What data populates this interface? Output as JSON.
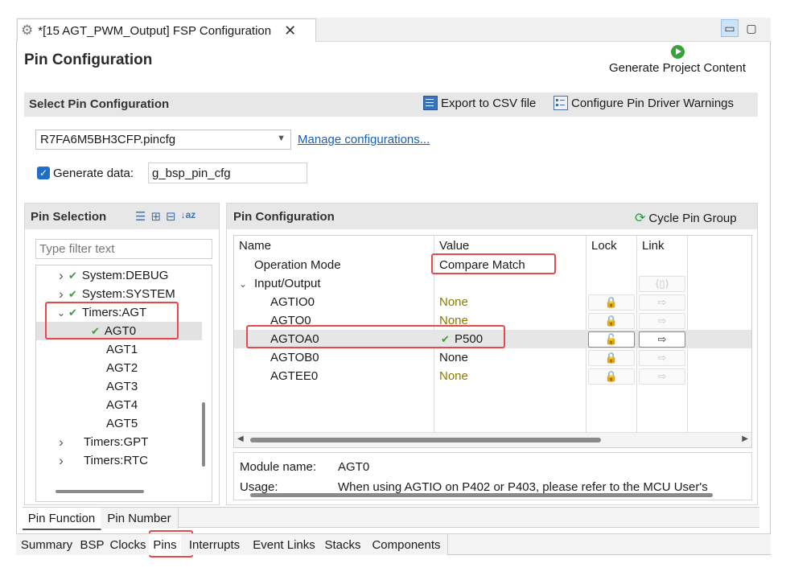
{
  "window": {
    "tab_title": "*[15 AGT_PWM_Output] FSP Configuration",
    "minimize_icon": "minimize-icon",
    "maximize_icon": "maximize-icon"
  },
  "header": {
    "title": "Pin Configuration",
    "generate_label": "Generate Project Content"
  },
  "select_config": {
    "title": "Select Pin Configuration",
    "export_label": "Export to CSV file",
    "warnings_label": "Configure Pin Driver Warnings",
    "config_value": "R7FA6M5BH3CFP.pincfg",
    "manage_link": "Manage configurations...",
    "generate_data_label": "Generate data:",
    "generate_data_checked": true,
    "generate_data_value": "g_bsp_pin_cfg"
  },
  "pin_selection": {
    "title": "Pin Selection",
    "filter_placeholder": "Type filter text",
    "tree": [
      {
        "label": "System:DEBUG",
        "indent": 1,
        "expander": "collapsed",
        "checked": true
      },
      {
        "label": "System:SYSTEM",
        "indent": 1,
        "expander": "collapsed",
        "checked": true
      },
      {
        "label": "Timers:AGT",
        "indent": 1,
        "expander": "expanded",
        "checked": true
      },
      {
        "label": "AGT0",
        "indent": 2,
        "expander": "none",
        "checked": true,
        "selected": true
      },
      {
        "label": "AGT1",
        "indent": 2,
        "expander": "none",
        "checked": false
      },
      {
        "label": "AGT2",
        "indent": 2,
        "expander": "none",
        "checked": false
      },
      {
        "label": "AGT3",
        "indent": 2,
        "expander": "none",
        "checked": false
      },
      {
        "label": "AGT4",
        "indent": 2,
        "expander": "none",
        "checked": false
      },
      {
        "label": "AGT5",
        "indent": 2,
        "expander": "none",
        "checked": false
      },
      {
        "label": "Timers:GPT",
        "indent": 1,
        "expander": "collapsed",
        "checked": false
      },
      {
        "label": "Timers:RTC",
        "indent": 1,
        "expander": "collapsed",
        "checked": false
      }
    ]
  },
  "pin_config": {
    "title": "Pin Configuration",
    "cycle_label": "Cycle Pin Group",
    "columns": {
      "name": "Name",
      "value": "Value",
      "lock": "Lock",
      "link": "Link"
    },
    "rows": [
      {
        "name": "Operation Mode",
        "value": "Compare Match",
        "style": "normal"
      },
      {
        "name": "Input/Output",
        "value": "",
        "style": "group"
      },
      {
        "name": "AGTIO0",
        "value": "None",
        "style": "olive"
      },
      {
        "name": "AGTO0",
        "value": "None",
        "style": "olive"
      },
      {
        "name": "AGTOA0",
        "value": "P500",
        "style": "checked"
      },
      {
        "name": "AGTOB0",
        "value": "None",
        "style": "normal"
      },
      {
        "name": "AGTEE0",
        "value": "None",
        "style": "olive"
      }
    ],
    "module_name_label": "Module name:",
    "module_name_value": "AGT0",
    "usage_label": "Usage:",
    "usage_value": "When using AGTIO on P402 or P403, please refer to the MCU User's"
  },
  "bottom_tabs": {
    "pin_tabs": [
      "Pin Function",
      "Pin Number"
    ],
    "editor_tabs": [
      "Summary",
      "BSP",
      "Clocks",
      "Pins",
      "Interrupts",
      "Event Links",
      "Stacks",
      "Components"
    ],
    "active_editor_tab": "Pins"
  },
  "colors": {
    "accent_link": "#1a5fb4",
    "highlight_box": "#e8484a",
    "check_green": "#3a9d3a",
    "olive_value": "#8a7a00"
  }
}
